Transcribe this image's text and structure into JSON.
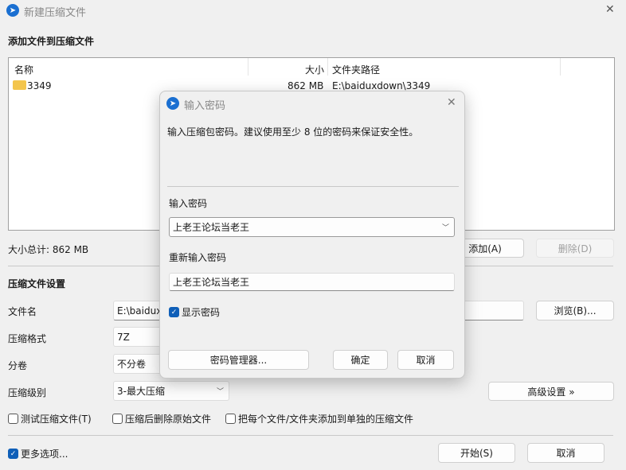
{
  "window": {
    "title": "新建压缩文件",
    "close": "✕"
  },
  "files": {
    "heading": "添加文件到压缩文件",
    "columns": [
      "名称",
      "大小",
      "文件夹路径"
    ],
    "rows": [
      {
        "name": "3349",
        "size": "862 MB",
        "path": "E:\\baiduxdown\\3349"
      }
    ],
    "total": "大小总计: 862 MB",
    "add": "添加(A)",
    "delete": "删除(D)"
  },
  "settings": {
    "heading": "压缩文件设置",
    "filename_label": "文件名",
    "filename": "E:\\baidux",
    "browse": "浏览(B)...",
    "format_label": "压缩格式",
    "format": "7Z",
    "split_label": "分卷",
    "split": "不分卷",
    "level_label": "压缩级别",
    "level": "3-最大压缩",
    "advanced": "高级设置 »",
    "test": "测试压缩文件(T)",
    "delete_after": "压缩后删除原始文件",
    "separate": "把每个文件/文件夹添加到单独的压缩文件"
  },
  "footer": {
    "more": "更多选项...",
    "start": "开始(S)",
    "cancel": "取消"
  },
  "dialog": {
    "title": "输入密码",
    "close": "✕",
    "hint": "输入压缩包密码。建议使用至少 8 位的密码来保证安全性。",
    "pw_label": "输入密码",
    "pw": "上老王论坛当老王",
    "pw2_label": "重新输入密码",
    "pw2": "上老王论坛当老王",
    "show": "显示密码",
    "manager": "密码管理器...",
    "ok": "确定",
    "cancel": "取消"
  }
}
